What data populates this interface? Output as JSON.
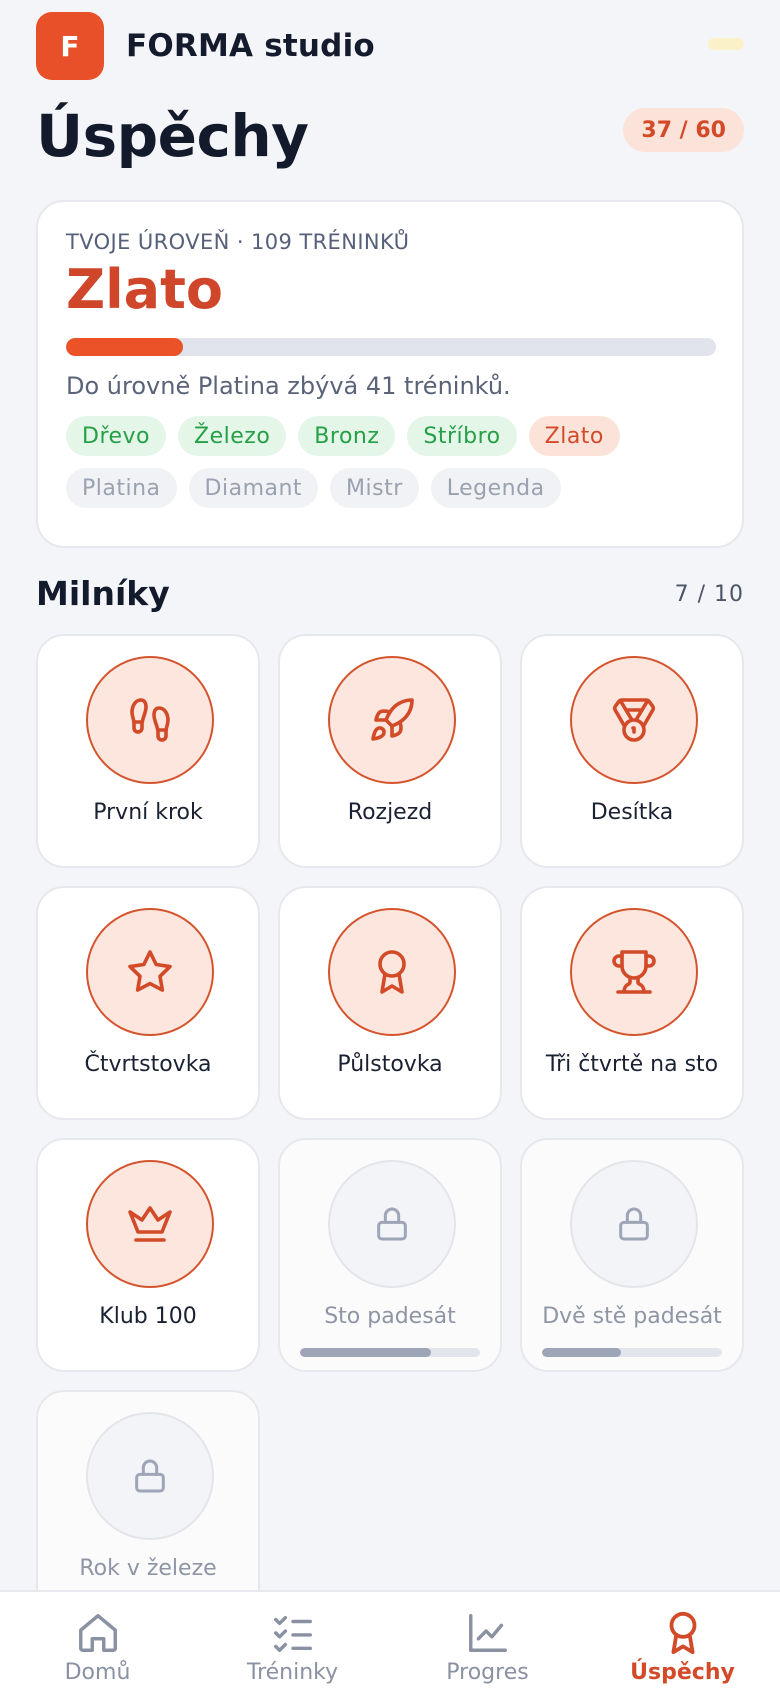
{
  "app": {
    "logo_letter": "F",
    "name": "FORMA studio"
  },
  "page": {
    "title": "Úspěchy",
    "achievements_count": "37 / 60"
  },
  "level": {
    "caption": "TVOJE ÚROVEŇ · 109 TRÉNINKŮ",
    "name": "Zlato",
    "progress_fraction": 0.18,
    "note": "Do úrovně Platina zbývá 41 tréninků.",
    "tiers": [
      {
        "label": "Dřevo",
        "state": "done"
      },
      {
        "label": "Železo",
        "state": "done"
      },
      {
        "label": "Bronz",
        "state": "done"
      },
      {
        "label": "Stříbro",
        "state": "done"
      },
      {
        "label": "Zlato",
        "state": "current"
      },
      {
        "label": "Platina",
        "state": "locked"
      },
      {
        "label": "Diamant",
        "state": "locked"
      },
      {
        "label": "Mistr",
        "state": "locked"
      },
      {
        "label": "Legenda",
        "state": "locked"
      }
    ]
  },
  "milestones": {
    "title": "Milníky",
    "count": "7 / 10",
    "items": [
      {
        "label": "První krok",
        "icon": "footprints-icon",
        "unlocked": true
      },
      {
        "label": "Rozjezd",
        "icon": "rocket-icon",
        "unlocked": true
      },
      {
        "label": "Desítka",
        "icon": "medal-icon",
        "unlocked": true
      },
      {
        "label": "Čtvrtstovka",
        "icon": "star-icon",
        "unlocked": true
      },
      {
        "label": "Půlstovka",
        "icon": "award-ribbon-icon",
        "unlocked": true
      },
      {
        "label": "Tři čtvrtě na sto",
        "icon": "trophy-icon",
        "unlocked": true
      },
      {
        "label": "Klub 100",
        "icon": "crown-icon",
        "unlocked": true
      },
      {
        "label": "Sto padesát",
        "icon": "lock-icon",
        "unlocked": false,
        "progress_fraction": 0.73
      },
      {
        "label": "Dvě stě padesát",
        "icon": "lock-icon",
        "unlocked": false,
        "progress_fraction": 0.44
      },
      {
        "label": "Rok v železe",
        "icon": "lock-icon",
        "unlocked": false
      }
    ]
  },
  "nav": {
    "items": [
      {
        "label": "Domů",
        "icon": "home-icon",
        "active": false
      },
      {
        "label": "Tréninky",
        "icon": "checklist-icon",
        "active": false
      },
      {
        "label": "Progres",
        "icon": "chart-icon",
        "active": false
      },
      {
        "label": "Úspěchy",
        "icon": "award-icon",
        "active": true
      }
    ]
  },
  "colors": {
    "accent": "#E8502A",
    "accent_text": "#D24A28",
    "done_green": "#25A047",
    "background": "#F4F5F8"
  }
}
